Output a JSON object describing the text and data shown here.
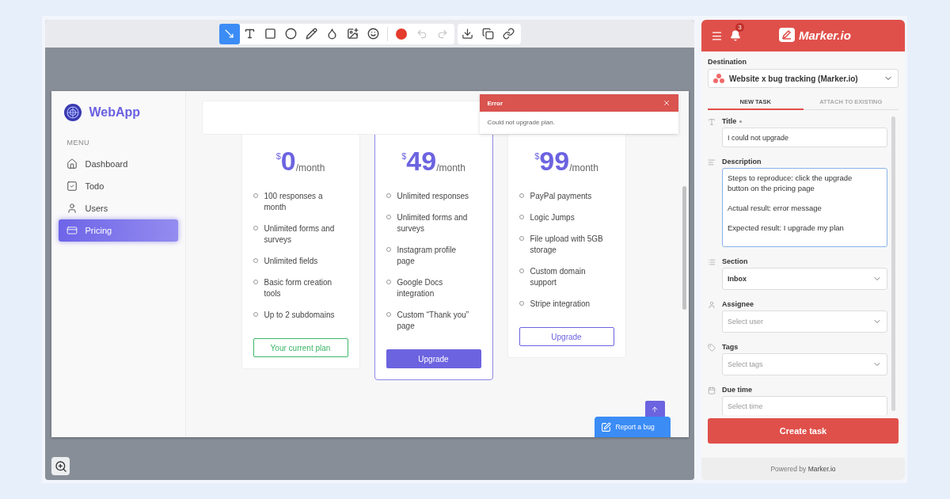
{
  "toolbar": {
    "tools": [
      {
        "kind": "arrow",
        "selected": true
      },
      {
        "kind": "text",
        "selected": false
      },
      {
        "kind": "rectangle",
        "selected": false
      },
      {
        "kind": "ellipse",
        "selected": false
      },
      {
        "kind": "pencil",
        "selected": false
      },
      {
        "kind": "blur",
        "selected": false
      },
      {
        "kind": "image",
        "selected": false
      },
      {
        "kind": "emoji",
        "selected": false
      }
    ],
    "color": "#e53b2c",
    "history": [
      {
        "kind": "undo",
        "disabled": true
      },
      {
        "kind": "redo",
        "disabled": true
      }
    ],
    "actions": [
      {
        "kind": "download"
      },
      {
        "kind": "copy"
      },
      {
        "kind": "link"
      }
    ]
  },
  "webapp": {
    "logo": "WebApp",
    "menu_heading": "MENU",
    "menu": [
      {
        "kind": "home",
        "label": "Dashboard",
        "selected": false
      },
      {
        "kind": "todo",
        "label": "Todo",
        "selected": false
      },
      {
        "kind": "users",
        "label": "Users",
        "selected": false
      },
      {
        "kind": "pricing",
        "label": "Pricing",
        "selected": true
      }
    ],
    "plans": [
      {
        "currency": "$",
        "amount": "0",
        "period": "/month",
        "highlighted": false,
        "features": [
          "100 responses a month",
          "Unlimited forms and surveys",
          "Unlimited fields",
          "Basic form creation tools",
          "Up to 2 subdomains"
        ],
        "button": {
          "kind": "current",
          "label": "Your current plan"
        }
      },
      {
        "currency": "$",
        "amount": "49",
        "period": "/month",
        "highlighted": true,
        "features": [
          "Unlimited responses",
          "Unlimited forms and surveys",
          "Instagram profile page",
          "Google Docs integration",
          "Custom “Thank you” page"
        ],
        "button": {
          "kind": "primary",
          "label": "Upgrade"
        }
      },
      {
        "currency": "$",
        "amount": "99",
        "period": "/month",
        "highlighted": false,
        "features": [
          "PayPal payments",
          "Logic Jumps",
          "File upload with 5GB storage",
          "Custom domain support",
          "Stripe integration"
        ],
        "button": {
          "kind": "outline",
          "label": "Upgrade"
        }
      }
    ],
    "toast": {
      "title": "Error",
      "message": "Could not upgrade plan."
    },
    "report_button": "Report a bug"
  },
  "panel": {
    "notifications": "3",
    "brand": "Marker.io",
    "destination": {
      "label": "Destination",
      "value": "Website x bug tracking (Marker.io)"
    },
    "tabs": [
      {
        "label": "NEW TASK",
        "selected": true
      },
      {
        "label": "ATTACH TO EXISTING",
        "selected": false
      }
    ],
    "fields": [
      {
        "kind": "text",
        "label": "Title",
        "required": true,
        "value": "I could not upgrade"
      },
      {
        "kind": "textarea",
        "label": "Description",
        "required": false,
        "value": "Steps to reproduce: click the upgrade button on the pricing page\n\nActual result: error message\n\nExpected result: I upgrade my plan"
      },
      {
        "kind": "select",
        "label": "Section",
        "required": false,
        "value": "Inbox"
      },
      {
        "kind": "select",
        "label": "Assignee",
        "required": false,
        "placeholder": "Select user"
      },
      {
        "kind": "select",
        "label": "Tags",
        "required": false,
        "placeholder": "Select tags"
      },
      {
        "kind": "text",
        "label": "Due time",
        "required": false,
        "placeholder": "Select time"
      }
    ],
    "submit": "Create task",
    "footer": {
      "prefix": "Powered by",
      "brand": "Marker.io"
    }
  }
}
